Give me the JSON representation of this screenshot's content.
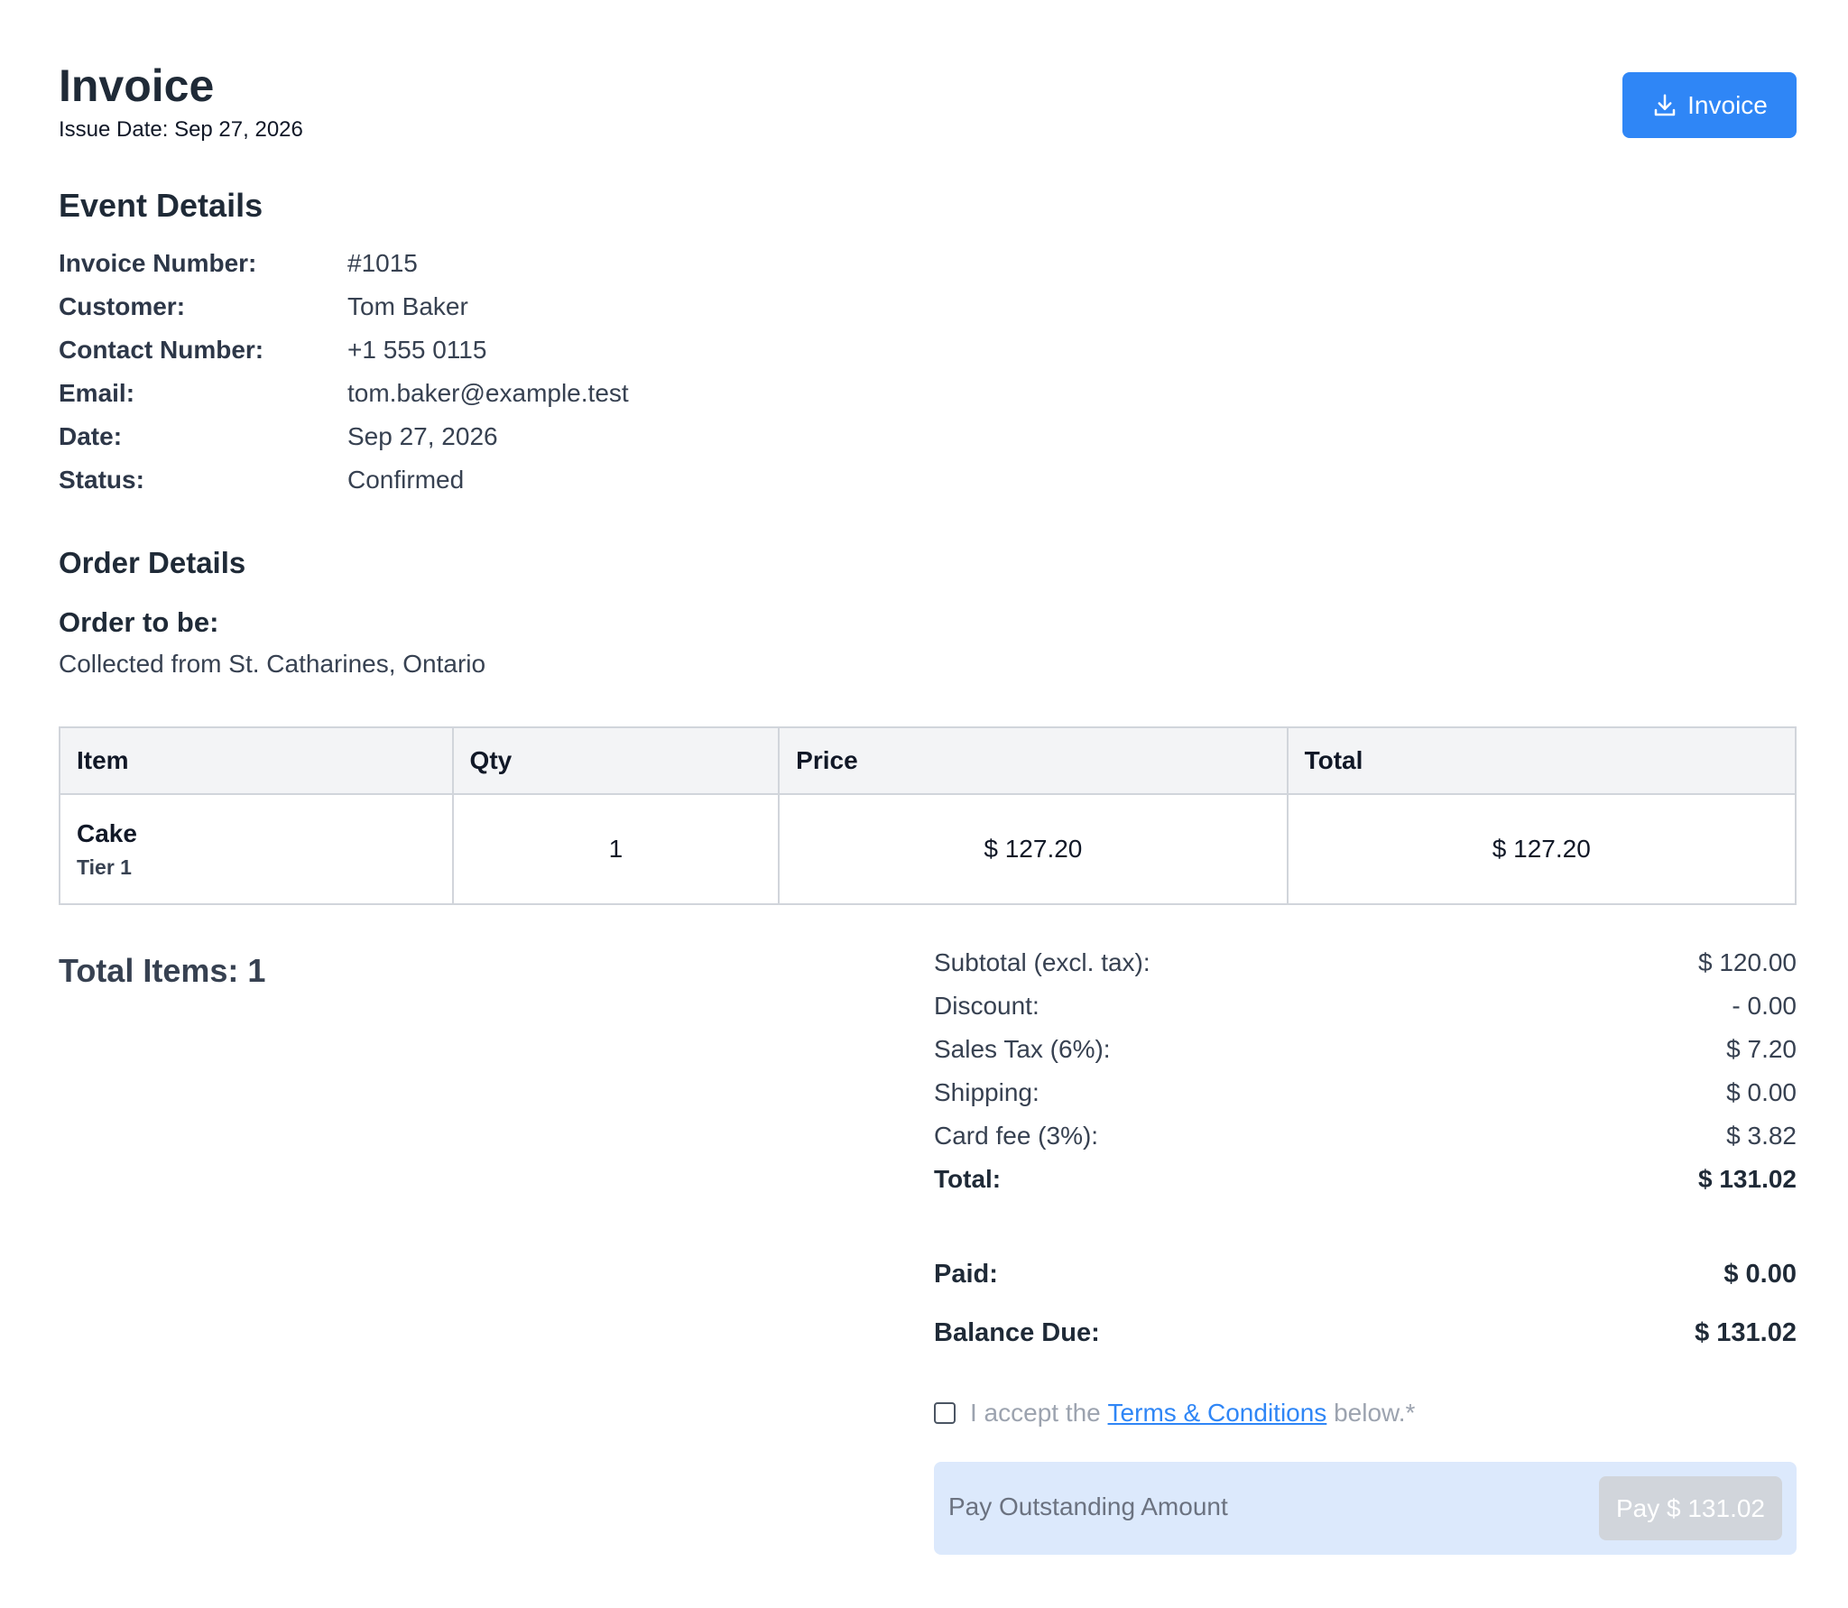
{
  "header": {
    "title": "Invoice",
    "issue_date": "Issue Date: Sep 27, 2026",
    "download_label": "Invoice"
  },
  "event_details": {
    "heading": "Event Details",
    "rows": [
      {
        "label": "Invoice Number:",
        "value": "#1015"
      },
      {
        "label": "Customer:",
        "value": "Tom Baker"
      },
      {
        "label": "Contact Number:",
        "value": "+1 555 0115"
      },
      {
        "label": "Email:",
        "value": "tom.baker@example.test"
      },
      {
        "label": "Date:",
        "value": "Sep 27, 2026"
      },
      {
        "label": "Status:",
        "value": "Confirmed"
      }
    ]
  },
  "order_details": {
    "heading": "Order Details",
    "sub_heading": "Order to be:",
    "fulfilment": "Collected from St. Catharines, Ontario"
  },
  "items_table": {
    "headers": [
      "Item",
      "Qty",
      "Price",
      "Total"
    ],
    "rows": [
      {
        "name": "Cake",
        "variant": "Tier 1",
        "qty": "1",
        "price": "$ 127.20",
        "total": "$ 127.20"
      }
    ]
  },
  "total_items": "Total Items: 1",
  "summary": {
    "rows": [
      {
        "label": "Subtotal (excl. tax):",
        "value": "$ 120.00"
      },
      {
        "label": "Discount:",
        "value": "- 0.00"
      },
      {
        "label": "Sales Tax (6%):",
        "value": "$ 7.20"
      },
      {
        "label": "Shipping:",
        "value": "$ 0.00"
      },
      {
        "label": "Card fee (3%):",
        "value": "$ 3.82"
      },
      {
        "label": "Total:",
        "value": "$ 131.02"
      }
    ],
    "paid_label": "Paid:",
    "paid_value": "$ 0.00",
    "balance_label": "Balance Due:",
    "balance_value": "$ 131.02"
  },
  "terms": {
    "prefix": "I accept the",
    "link": "Terms & Conditions",
    "suffix": "below.*"
  },
  "payment": {
    "label": "Pay Outstanding Amount",
    "button": "Pay $ 131.02"
  },
  "colors": {
    "accent": "#2f86f6",
    "pay_bar": "#dce9fc",
    "disabled_button": "#d1d5db"
  }
}
